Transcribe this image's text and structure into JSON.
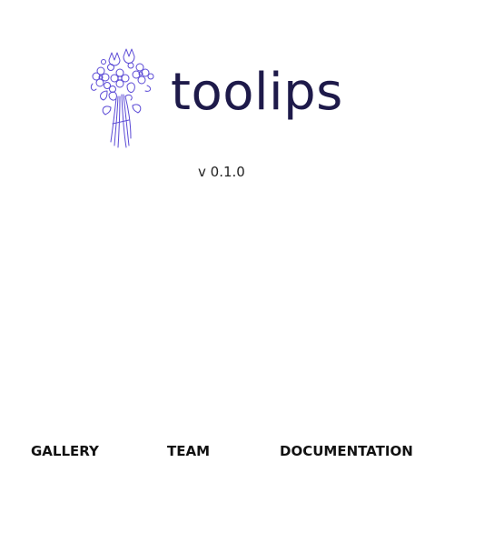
{
  "logo": {
    "wordmark": "toolips",
    "icon": "flower-bouquet-icon",
    "colors": {
      "wordmark": "#1e1a4a",
      "bouquet": "#5b4ad6"
    }
  },
  "version": "v 0.1.0",
  "nav": {
    "items": [
      {
        "label": "GALLERY"
      },
      {
        "label": "TEAM"
      },
      {
        "label": "DOCUMENTATION"
      }
    ]
  }
}
